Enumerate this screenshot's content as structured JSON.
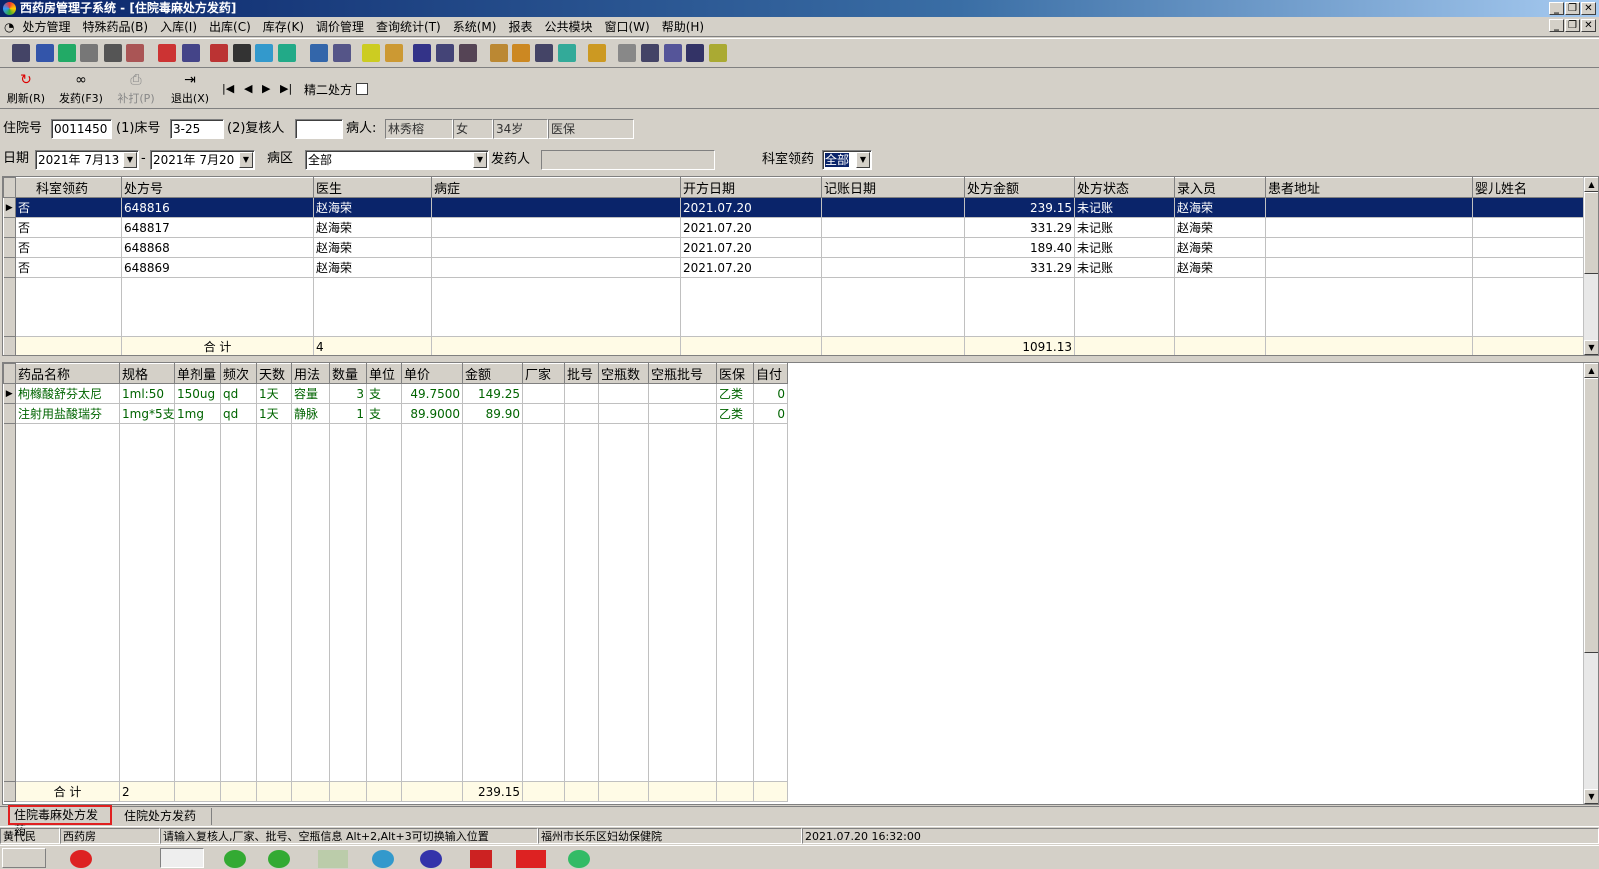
{
  "window": {
    "title": "西药房管理子系统 - [住院毒麻处方发药]"
  },
  "menu": [
    "处方管理",
    "特殊药品(B)",
    "入库(I)",
    "出库(C)",
    "库存(K)",
    "调价管理",
    "查询统计(T)",
    "系统(M)",
    "报表",
    "公共模块",
    "窗口(W)",
    "帮助(H)"
  ],
  "toolbar2": {
    "refresh": "刷新(R)",
    "dispense": "发药(F3)",
    "reprint": "补打(P)",
    "exit": "退出(X)",
    "nav_first": "|◀",
    "nav_prev": "◀",
    "nav_next": "▶",
    "nav_last": "▶|",
    "jing2": "精二处方"
  },
  "form": {
    "admission_label": "住院号",
    "admission_value": "0011450",
    "bed_label": "(1)床号",
    "bed_value": "3-25",
    "checker_label": "(2)复核人",
    "checker_value": "",
    "patient_label": "病人:",
    "patient_name": "林秀榕",
    "patient_sex": "女",
    "patient_age": "34岁",
    "patient_insurance": "医保",
    "date_label": "日期",
    "date_from": "2021年 7月13",
    "date_to": "2021年 7月20",
    "ward_label": "病区",
    "ward_value": "全部",
    "dispenser_label": "发药人",
    "dispenser_value": "",
    "dept_label": "科室领药",
    "dept_value": "全部"
  },
  "rx_table": {
    "columns": [
      "科室领药",
      "处方号",
      "医生",
      "病症",
      "开方日期",
      "记账日期",
      "处方金额",
      "处方状态",
      "录入员",
      "患者地址",
      "婴儿姓名"
    ],
    "rows": [
      [
        "否",
        "648816",
        "赵海荣",
        "",
        "2021.07.20",
        "",
        "239.15",
        "未记账",
        "赵海荣",
        "",
        ""
      ],
      [
        "否",
        "648817",
        "赵海荣",
        "",
        "2021.07.20",
        "",
        "331.29",
        "未记账",
        "赵海荣",
        "",
        ""
      ],
      [
        "否",
        "648868",
        "赵海荣",
        "",
        "2021.07.20",
        "",
        "189.40",
        "未记账",
        "赵海荣",
        "",
        ""
      ],
      [
        "否",
        "648869",
        "赵海荣",
        "",
        "2021.07.20",
        "",
        "331.29",
        "未记账",
        "赵海荣",
        "",
        ""
      ]
    ],
    "total_label": "合  计",
    "total_count": "4",
    "total_amount": "1091.13"
  },
  "drug_table": {
    "columns": [
      "药品名称",
      "规格",
      "单剂量",
      "频次",
      "天数",
      "用法",
      "数量",
      "单位",
      "单价",
      "金额",
      "厂家",
      "批号",
      "空瓶数",
      "空瓶批号",
      "医保",
      "自付"
    ],
    "rows": [
      [
        "枸橼酸舒芬太尼",
        "1ml:50",
        "150ug",
        "qd",
        "1天",
        "容量",
        "3",
        "支",
        "49.7500",
        "149.25",
        "",
        "",
        "",
        "",
        "乙类",
        "0"
      ],
      [
        "注射用盐酸瑞芬",
        "1mg*5支",
        "1mg",
        "qd",
        "1天",
        "静脉",
        "1",
        "支",
        "89.9000",
        "89.90",
        "",
        "",
        "",
        "",
        "乙类",
        "0"
      ]
    ],
    "total_label": "合  计",
    "total_count": "2",
    "total_amount": "239.15"
  },
  "tabs": [
    "住院毒麻处方发药",
    "住院处方发药"
  ],
  "status": {
    "user": "黄代民",
    "dept": "西药房",
    "hint": "请输入复核人,厂家、批号、空瓶信息  Alt+2,Alt+3可切换输入位置",
    "hospital": "福州市长乐区妇幼保健院",
    "datetime": "2021.07.20 16:32:00"
  }
}
